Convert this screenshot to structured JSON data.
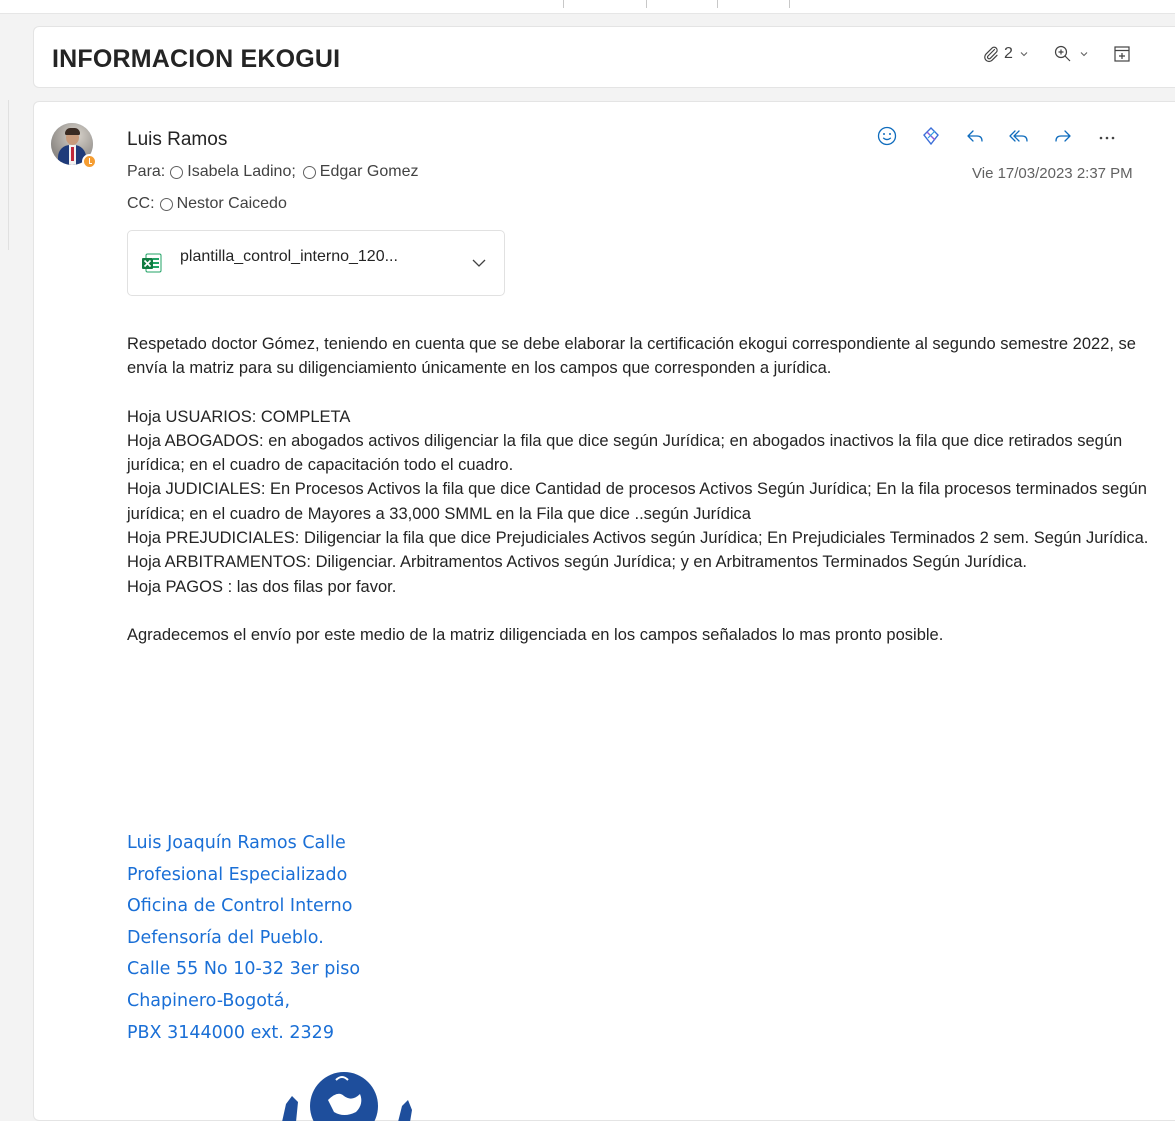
{
  "subject": "INFORMACION EKOGUI",
  "toolbar": {
    "attachments_count": "2"
  },
  "message": {
    "sender": "Luis Ramos",
    "to_label": "Para:",
    "to": [
      "Isabela Ladino;",
      "Edgar Gomez"
    ],
    "cc_label": "CC:",
    "cc": [
      "Nestor Caicedo"
    ],
    "timestamp": "Vie 17/03/2023 2:37 PM",
    "attachment": {
      "name": "plantilla_control_interno_120...",
      "icon": "excel-file-icon"
    },
    "actions": [
      "emoji-icon",
      "loop-icon",
      "reply-icon",
      "reply-all-icon",
      "forward-icon",
      "more-icon"
    ]
  },
  "body": {
    "intro": "Respetado doctor Gómez, teniendo en cuenta que se debe elaborar la certificación ekogui correspondiente al segundo semestre 2022, se envía la matriz para su diligenciamiento únicamente en los campos que corresponden a jurídica.",
    "lines": [
      "Hoja USUARIOS: COMPLETA",
      "Hoja ABOGADOS:  en abogados activos diligenciar la fila que dice según Jurídica; en abogados inactivos la fila que dice retirados según jurídica;  en el cuadro de capacitación todo el cuadro.",
      "Hoja JUDICIALES:  En Procesos Activos la fila que dice Cantidad de procesos Activos Según Jurídica;  En la fila procesos terminados según jurídica; en el cuadro de Mayores a 33,000 SMML en la Fila que dice ..según Jurídica",
      "Hoja PREJUDICIALES: Diligenciar la fila que dice Prejudiciales Activos según Jurídica; En Prejudiciales Terminados 2 sem. Según Jurídica.",
      "Hoja ARBITRAMENTOS:  Diligenciar. Arbitramentos Activos según Jurídica; y en Arbitramentos Terminados Según Jurídica.",
      "Hoja PAGOS : las dos filas por favor."
    ],
    "closing": "Agradecemos el envío por este medio de la matriz diligenciada en los campos señalados lo mas pronto posible."
  },
  "signature": [
    "Luis Joaquín Ramos Calle",
    "Profesional Especializado",
    "Oficina de Control Interno",
    "Defensoría del Pueblo.",
    "Calle 55 No 10-32  3er piso",
    "Chapinero-Bogotá,",
    "PBX 3144000 ext.  2329"
  ],
  "colors": {
    "signature": "#1a6fd6",
    "action_icons": "#0f6cbd",
    "presence": "#f59d32",
    "logo": "#1e4e9c"
  }
}
